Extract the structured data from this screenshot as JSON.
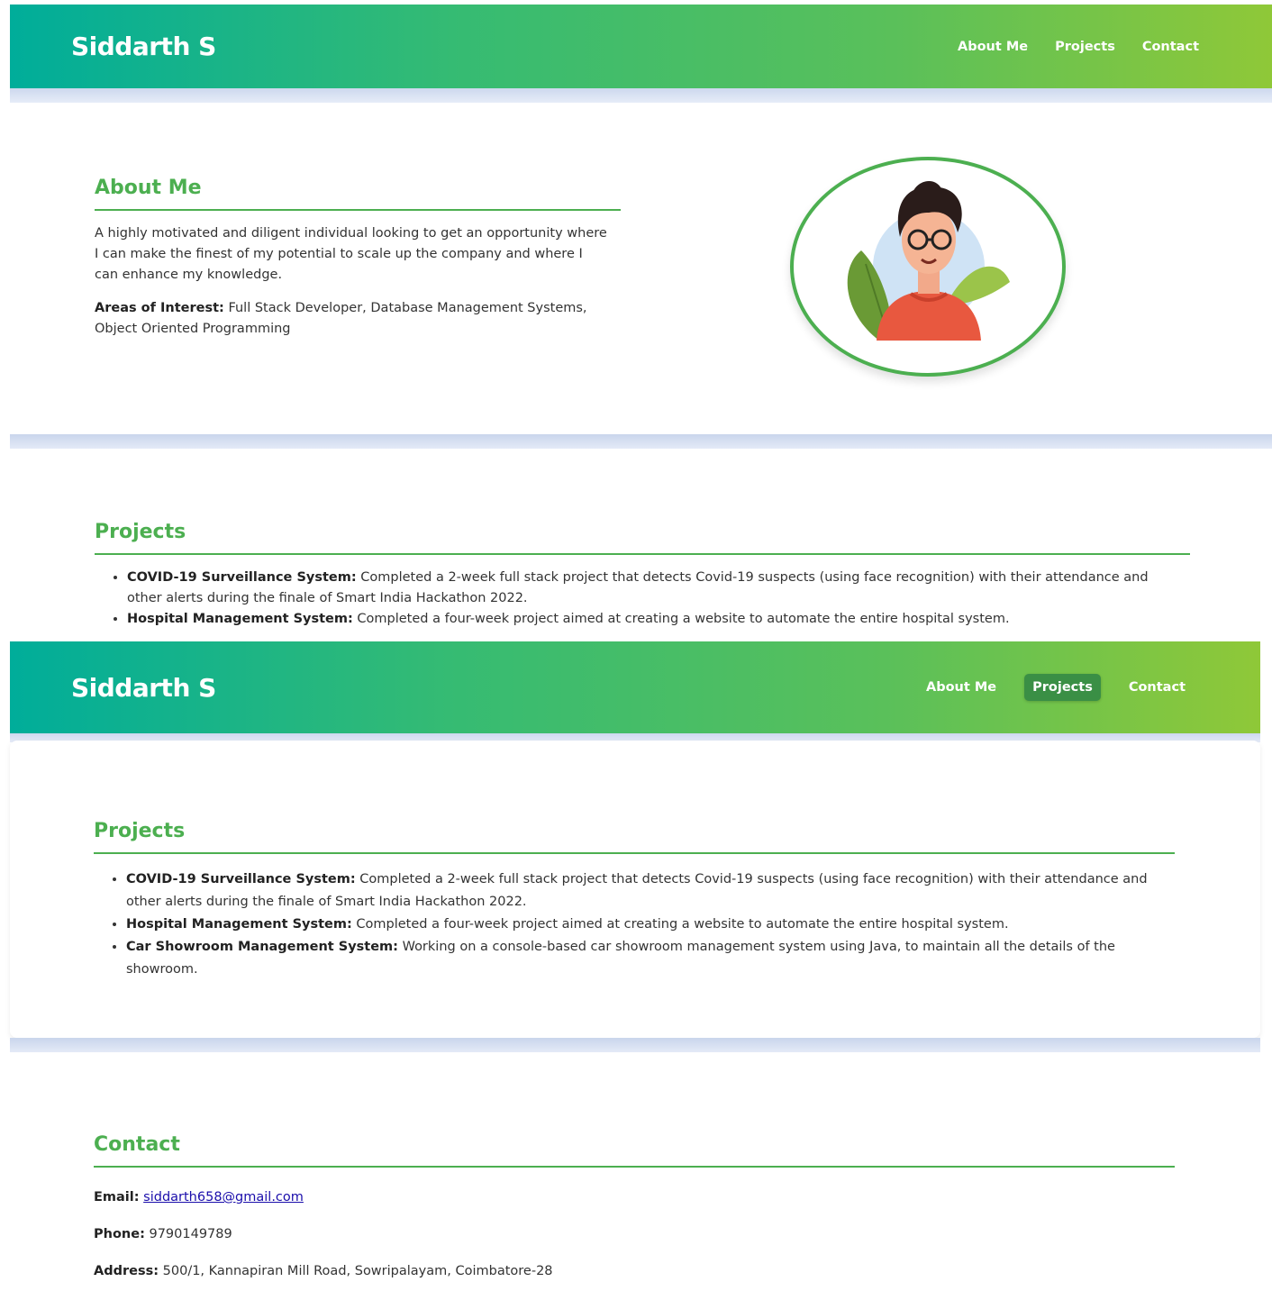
{
  "brand": "Siddarth S",
  "nav": {
    "about": "About Me",
    "projects": "Projects",
    "contact": "Contact"
  },
  "about": {
    "heading": "About Me",
    "text": "A highly motivated and diligent individual looking to get an opportunity where I can make the finest of my potential to scale up the company and where I can enhance my knowledge.",
    "interest_label": "Areas of Interest:",
    "interest_text": "Full Stack Developer, Database Management Systems, Object Oriented Programming"
  },
  "projects": {
    "heading": "Projects",
    "items": [
      {
        "title": "COVID-19 Surveillance System:",
        "desc": "Completed a 2-week full stack project that detects Covid-19 suspects (using face recognition) with their attendance and other alerts during the finale of Smart India Hackathon 2022."
      },
      {
        "title": "Hospital Management System:",
        "desc": "Completed a four-week project aimed at creating a website to automate the entire hospital system."
      },
      {
        "title": "Car Showroom Management System:",
        "desc": "Working on a console-based car showroom management system using Java, to maintain all the details of the showroom."
      }
    ]
  },
  "contact": {
    "heading": "Contact",
    "email_label": "Email:",
    "email": "siddarth658@gmail.com",
    "phone_label": "Phone:",
    "phone": "9790149789",
    "address_label": "Address:",
    "address": "500/1, Kannapiran Mill Road, Sowripalayam, Coimbatore-28"
  },
  "colors": {
    "accent": "#4caf50",
    "header_start": "#00ad9a",
    "header_end": "#8fc838",
    "active_nav": "#3a8f45"
  },
  "icons": {
    "avatar": "avatar-illustration"
  }
}
